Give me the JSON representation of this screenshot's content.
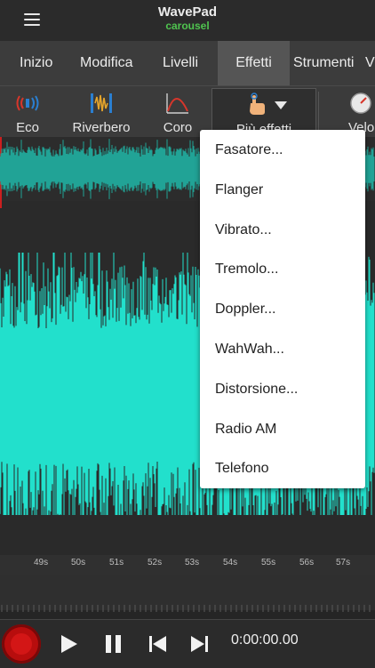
{
  "app": {
    "title": "WavePad",
    "subtitle": "carousel"
  },
  "tabs": [
    {
      "label": "Inizio",
      "active": false
    },
    {
      "label": "Modifica",
      "active": false
    },
    {
      "label": "Livelli",
      "active": false
    },
    {
      "label": "Effetti",
      "active": true
    },
    {
      "label": "Strumenti",
      "active": false
    },
    {
      "label": "V",
      "active": false
    }
  ],
  "toolbar": {
    "echo_label": "Eco",
    "reverb_label": "Riverbero",
    "chorus_label": "Coro",
    "more_label": "Più effetti",
    "speed_label": "Velo"
  },
  "menu": {
    "items": [
      "Fasatore...",
      "Flanger",
      "Vibrato...",
      "Tremolo...",
      "Doppler...",
      "WahWah...",
      "Distorsione...",
      "Radio AM",
      "Telefono"
    ]
  },
  "timeline": {
    "labels": [
      "49s",
      "50s",
      "51s",
      "52s",
      "53s",
      "54s",
      "55s",
      "56s",
      "57s"
    ]
  },
  "transport": {
    "time": "0:00:00.00"
  },
  "colors": {
    "accent_green": "#4fc34f",
    "wave": "#22e0cc",
    "wave_dark": "#21a396",
    "record": "#b70d0d"
  }
}
